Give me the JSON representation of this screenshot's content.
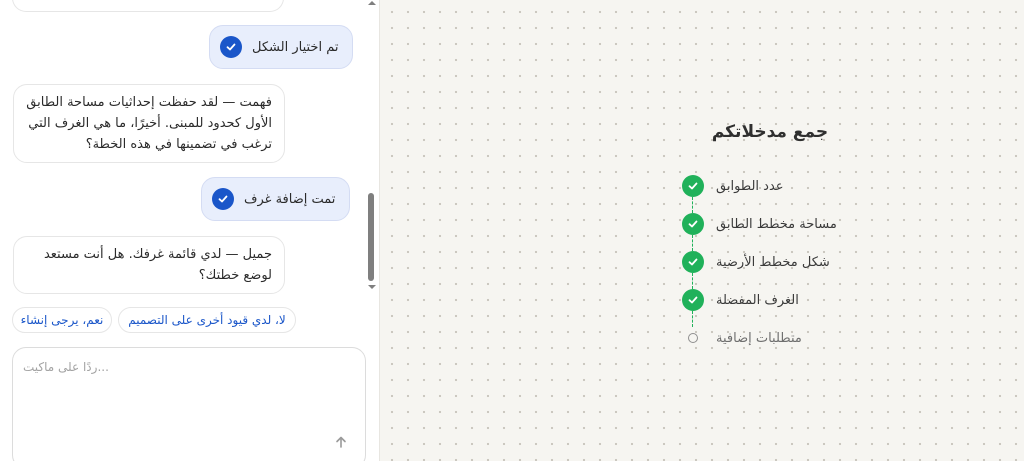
{
  "chat": {
    "messages": [
      {
        "role": "user",
        "text": "تم اختيار الشكل"
      },
      {
        "role": "assistant",
        "lines": [
          "فهمت — لقد حفظت إحداثيات مساحة الطابق",
          "الأول كحدود للمبنى. أخيرًا، ما هي الغرف التي",
          "ترغب في تضمينها في هذه الخطة؟"
        ]
      },
      {
        "role": "user",
        "text": "تمت إضافة غرف"
      },
      {
        "role": "assistant",
        "lines": [
          "جميل — لدي قائمة غرفك. هل أنت مستعد",
          "لوضع خطتك؟"
        ]
      }
    ],
    "quick_replies": [
      "لا، لدي قيود أخرى على التصميم",
      "نعم، يرجى إنشاء"
    ],
    "composer": {
      "placeholder": "...ردًا على ماكيت",
      "value": ""
    }
  },
  "progress": {
    "title": "جمع مدخلاتكم",
    "steps": [
      {
        "label": "عدد الطوابق",
        "status": "done"
      },
      {
        "label": "مساحة مخطط الطابق",
        "status": "done"
      },
      {
        "label": "شكل مخطط الأرضية",
        "status": "done"
      },
      {
        "label": "الغرف المفضلة",
        "status": "done"
      },
      {
        "label": "متطلبات إضافية",
        "status": "pending"
      }
    ]
  },
  "colors": {
    "accent": "#1a56c9",
    "success": "#20b15a",
    "user_bubble": "#e8eefc",
    "canvas_bg": "#f6f5f1"
  },
  "icons": {
    "user_message_status": "check-circle-icon",
    "step_done": "check-circle-icon",
    "step_pending": "empty-circle-icon",
    "send": "arrow-up-icon"
  }
}
